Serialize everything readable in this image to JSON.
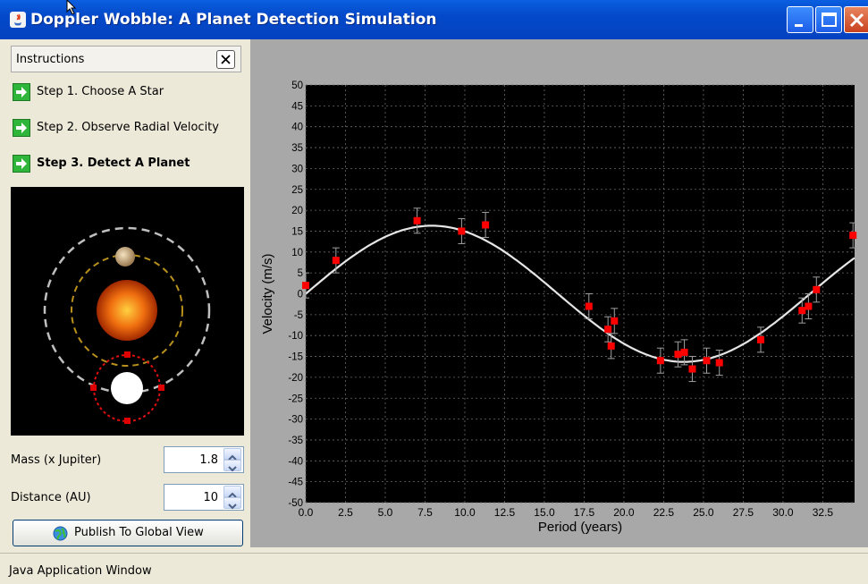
{
  "window": {
    "title": "Doppler Wobble: A Planet Detection Simulation"
  },
  "instructions": {
    "header_label": "Instructions",
    "steps": [
      {
        "label": "Step 1. Choose A Star",
        "active": false
      },
      {
        "label": "Step 2. Observe Radial Velocity",
        "active": false
      },
      {
        "label": "Step 3. Detect A Planet",
        "active": true
      }
    ]
  },
  "controls": {
    "mass_label": "Mass (x Jupiter)",
    "mass_value": "1.8",
    "distance_label": "Distance (AU)",
    "distance_value": "10",
    "publish_label": "Publish To Global View"
  },
  "status": {
    "text": "Java Application Window"
  },
  "colors": {
    "titlebar": "#0349c9",
    "point": "#ff0000",
    "curve": "#ffffff",
    "chart_bg": "#000000",
    "chart_frame": "#a8a8a8"
  },
  "icons": [
    "java-icon",
    "minimize-icon",
    "maximize-icon",
    "close-icon",
    "step-arrow-icon",
    "globe-icon",
    "spin-up-icon",
    "spin-down-icon",
    "mouse-cursor-icon"
  ],
  "chart_data": {
    "type": "scatter",
    "xlabel": "Period (years)",
    "ylabel": "Velocity (m/s)",
    "xlim": [
      0,
      34.5
    ],
    "ylim": [
      -50,
      50
    ],
    "x_ticks": [
      "0.0",
      "2.5",
      "5.0",
      "7.5",
      "10.0",
      "12.5",
      "15.0",
      "17.5",
      "20.0",
      "22.5",
      "25.0",
      "27.5",
      "30.0",
      "32.5"
    ],
    "y_ticks": [
      "50",
      "45",
      "40",
      "35",
      "30",
      "25",
      "20",
      "15",
      "10",
      "5",
      "0",
      "-5",
      "-10",
      "-15",
      "-20",
      "-25",
      "-30",
      "-35",
      "-40",
      "-45",
      "-50"
    ],
    "grid": true,
    "fit_curve": {
      "amplitude": 16.3,
      "period": 31.7,
      "phase": 0.0
    },
    "points": [
      {
        "x": 0.0,
        "y": 2
      },
      {
        "x": 1.9,
        "y": 8
      },
      {
        "x": 7.0,
        "y": 17.5
      },
      {
        "x": 9.8,
        "y": 15
      },
      {
        "x": 11.3,
        "y": 16.5
      },
      {
        "x": 17.8,
        "y": -3
      },
      {
        "x": 19.0,
        "y": -8.5
      },
      {
        "x": 19.2,
        "y": -12.5
      },
      {
        "x": 19.4,
        "y": -6.5
      },
      {
        "x": 22.3,
        "y": -16
      },
      {
        "x": 23.4,
        "y": -14.5
      },
      {
        "x": 23.8,
        "y": -14
      },
      {
        "x": 24.3,
        "y": -18
      },
      {
        "x": 25.2,
        "y": -16
      },
      {
        "x": 26.0,
        "y": -16.5
      },
      {
        "x": 28.6,
        "y": -11
      },
      {
        "x": 31.2,
        "y": -4
      },
      {
        "x": 31.6,
        "y": -3
      },
      {
        "x": 32.1,
        "y": 1
      },
      {
        "x": 34.4,
        "y": 14
      }
    ],
    "error_bar": 3
  }
}
